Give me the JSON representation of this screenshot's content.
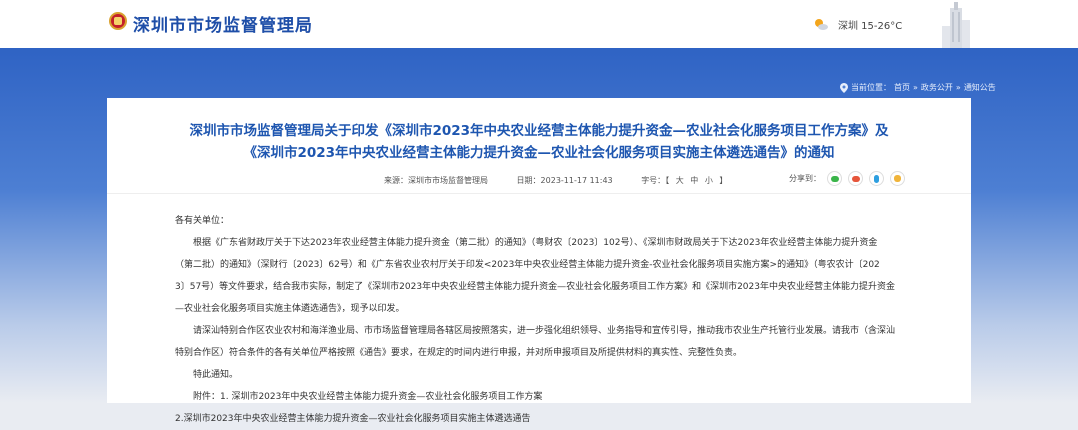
{
  "header": {
    "site_title": "深圳市市场监督管理局",
    "weather": "深圳 15-26°C"
  },
  "breadcrumb": {
    "label": "当前位置：",
    "items": [
      "首页",
      "政务公开",
      "通知公告"
    ],
    "separator": "»"
  },
  "article": {
    "title_line1": "深圳市市场监督管理局关于印发《深圳市2023年中央农业经营主体能力提升资金—农业社会化服务项目工作方案》及",
    "title_line2": "《深圳市2023年中央农业经营主体能力提升资金—农业社会化服务项目实施主体遴选通告》的通知",
    "source_label": "来源：",
    "source": "深圳市市场监督管理局",
    "date_label": "日期：",
    "date": "2023-11-17 11:43",
    "font_label": "字号：",
    "font_options": "【 大  中  小 】",
    "share_label": "分享到：",
    "greeting": "各有关单位：",
    "para1_line1": "根据《广东省财政厅关于下达2023年农业经营主体能力提升资金（第二批）的通知》（粤财农〔2023〕102号）、《深圳市财政局关于下达2023年农业经营主体能力提升资金",
    "para1_line2": "（第二批）的通知》（深财行〔2023〕62号）和《广东省农业农村厅关于印发<2023年中央农业经营主体能力提升资金-农业社会化服务项目实施方案>的通知》（粤农农计〔202",
    "para1_line3": "3〕57号）等文件要求，结合我市实际，制定了《深圳市2023年中央农业经营主体能力提升资金—农业社会化服务项目工作方案》和《深圳市2023年中央农业经营主体能力提升资金",
    "para1_line4": "—农业社会化服务项目实施主体遴选通告》，现予以印发。",
    "para2_line1": "请深汕特别合作区农业农村和海洋渔业局、市市场监督管理局各辖区局按照落实，进一步强化组织领导、业务指导和宣传引导，推动我市农业生产托管行业发展。请我市（含深汕",
    "para2_line2": "特别合作区）符合条件的各有关单位严格按照《通告》要求，在规定的时间内进行申报，并对所申报项目及所提供材料的真实性、完整性负责。",
    "special_notice": "特此通知。",
    "attachment_1": "附件：1. 深圳市2023年中央农业经营主体能力提升资金—农业社会化服务项目工作方案",
    "attachment_2": "2.深圳市2023年中央农业经营主体能力提升资金—农业社会化服务项目实施主体遴选通告"
  },
  "colors": {
    "title_blue": "#1e56b0",
    "banner_blue": "#2f63c4",
    "share_wechat": "#3bb54a",
    "share_weibo": "#e6553a",
    "share_qq": "#2d9fe0",
    "share_qzone": "#f0b43a"
  }
}
